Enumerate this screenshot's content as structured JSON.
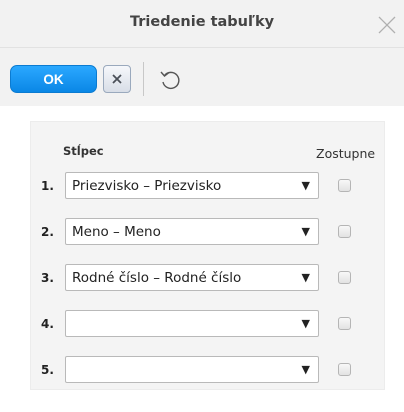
{
  "dialog": {
    "title": "Triedenie tabuľky"
  },
  "toolbar": {
    "ok_label": "OK",
    "cancel_icon": "close-icon",
    "undo_icon": "undo-icon"
  },
  "sort": {
    "column_header": "Stĺpec",
    "descending_header": "Zostupne",
    "rows": [
      {
        "number": "1.",
        "value": "Priezvisko – Priezvisko",
        "descending": false
      },
      {
        "number": "2.",
        "value": "Meno – Meno",
        "descending": false
      },
      {
        "number": "3.",
        "value": "Rodné číslo – Rodné číslo",
        "descending": false
      },
      {
        "number": "4.",
        "value": "",
        "descending": false
      },
      {
        "number": "5.",
        "value": "",
        "descending": false
      }
    ]
  },
  "colors": {
    "ok_button": "#1a98f3",
    "title_bar": "#f2f2f2",
    "panel": "#f4f4f4"
  }
}
